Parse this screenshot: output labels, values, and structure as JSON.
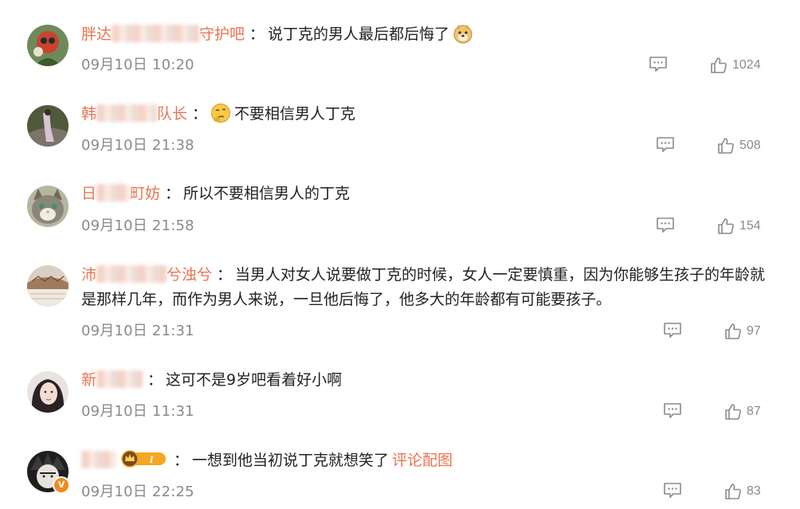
{
  "comments": [
    {
      "user_prefix": "胖达",
      "user_suffix": "守护吧",
      "separator": "：",
      "text": "说丁克的男人最后都后悔了",
      "emoji": "doge-emoji",
      "time": "09月10日 10:20",
      "likes": "1024"
    },
    {
      "user_prefix": "韩",
      "user_suffix": "队长",
      "separator": "：",
      "emoji_before": "thinking-emoji",
      "text": "不要相信男人丁克",
      "time": "09月10日 21:38",
      "likes": "508"
    },
    {
      "user_prefix": "日",
      "user_suffix": "町妨",
      "separator": "：",
      "text": "所以不要相信男人的丁克",
      "time": "09月10日 21:58",
      "likes": "154"
    },
    {
      "user_prefix": "沛",
      "user_suffix": "兮浊兮",
      "separator": "：",
      "text": "当男人对女人说要做丁克的时候，女人一定要慎重，因为你能够生孩子的年龄就是那样几年，而作为男人来说，一旦他后悔了，他多大的年龄都有可能要孩子。",
      "time": "09月10日 21:31",
      "likes": "97"
    },
    {
      "user_prefix": "新",
      "user_suffix": "",
      "separator": "：",
      "text": "这可不是9岁吧看着好小啊",
      "time": "09月10日 11:31",
      "likes": "87"
    },
    {
      "user_prefix": "",
      "user_suffix": "",
      "separator": "：",
      "badge_level": "I",
      "text": "一想到他当初说丁克就想笑了",
      "image_link": "评论配图",
      "verified_mark": "V",
      "time": "09月10日 22:25",
      "likes": "83"
    }
  ],
  "colors": {
    "username": "#eb7350",
    "text": "#222222",
    "meta": "#8a8a8a",
    "icon": "#8a8a8a",
    "verified": "#f08a1e"
  },
  "icons": {
    "reply": "comment-icon",
    "like": "thumbs-up-icon"
  }
}
